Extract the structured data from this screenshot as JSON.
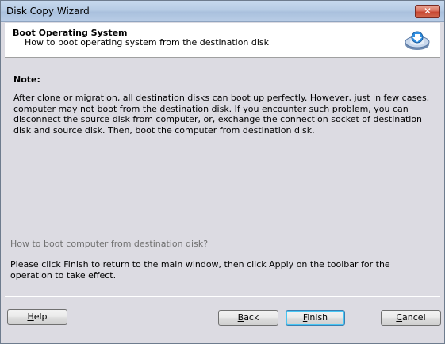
{
  "window": {
    "title": "Disk Copy Wizard",
    "close_glyph": "✕"
  },
  "header": {
    "title": "Boot Operating System",
    "subtitle": "How to boot operating system from the destination disk",
    "icon": "disk-download-icon"
  },
  "content": {
    "note_label": "Note:",
    "note_text": "After clone or migration, all destination disks can boot up perfectly. However, just in few cases, computer may not boot from the destination disk. If you encounter such problem, you can disconnect the source disk from computer, or, exchange the connection socket of destination disk and source disk. Then, boot the computer from destination disk.",
    "question": "How to boot computer from destination disk?",
    "answer": "Please click Finish to return to the main window, then click Apply on the toolbar for the operation to take effect."
  },
  "buttons": {
    "help": {
      "mnemonic": "H",
      "rest": "elp"
    },
    "back": {
      "mnemonic": "B",
      "rest": "ack"
    },
    "finish": {
      "mnemonic": "F",
      "rest": "inish"
    },
    "cancel": {
      "mnemonic": "C",
      "rest": "ancel"
    }
  }
}
